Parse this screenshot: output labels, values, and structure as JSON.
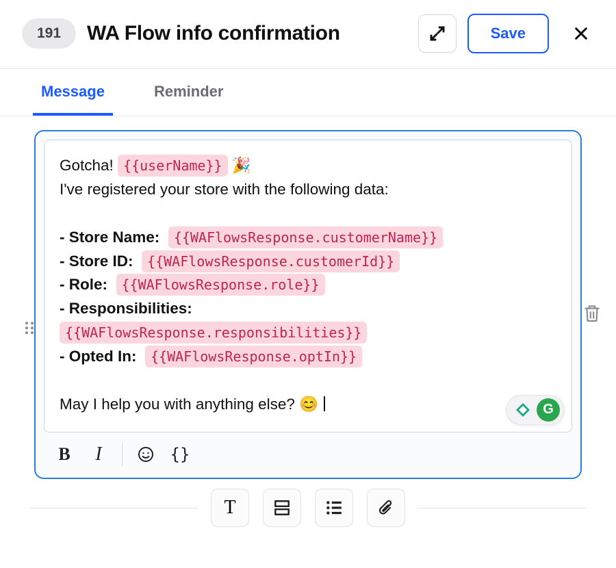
{
  "header": {
    "id": "191",
    "title": "WA Flow info confirmation",
    "save_label": "Save"
  },
  "tabs": {
    "message": "Message",
    "reminder": "Reminder",
    "active": "message"
  },
  "msg": {
    "line1_pre": "Gotcha! ",
    "var_user": "{{userName}}",
    "line1_post": " 🎉",
    "line2": "I've registered your store with the following data:",
    "items": {
      "storeName": {
        "label": "- Store Name:",
        "var": "{{WAFlowsResponse.customerName}}"
      },
      "storeId": {
        "label": "- Store ID:",
        "var": "{{WAFlowsResponse.customerId}}"
      },
      "role": {
        "label": "- Role:",
        "var": "{{WAFlowsResponse.role}}"
      },
      "resp": {
        "label": "- Responsibilities:",
        "var": "{{WAFlowsResponse.responsibilities}}"
      },
      "optin": {
        "label": "- Opted In:",
        "var": "{{WAFlowsResponse.optIn}}"
      }
    },
    "closing": "May I help you with anything else? 😊"
  },
  "fmt": {
    "bold": "B",
    "italic": "I",
    "emoji": "☺",
    "braces": "{}"
  },
  "add": {
    "text": "T"
  },
  "grammarly": {
    "glyph": "G"
  }
}
